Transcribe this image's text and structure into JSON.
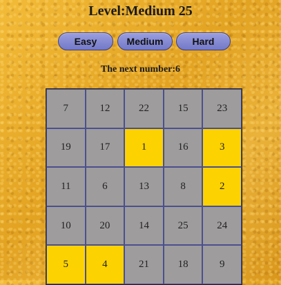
{
  "title": "Level:Medium 25",
  "levels": {
    "easy": "Easy",
    "medium": "Medium",
    "hard": "Hard"
  },
  "next_number_text": "The next number:6",
  "colors": {
    "cell": "#9e9c9c",
    "found_cell": "#fcd200",
    "button": "#7c82cc"
  },
  "grid": [
    [
      {
        "n": "7",
        "found": false
      },
      {
        "n": "12",
        "found": false
      },
      {
        "n": "22",
        "found": false
      },
      {
        "n": "15",
        "found": false
      },
      {
        "n": "23",
        "found": false
      }
    ],
    [
      {
        "n": "19",
        "found": false
      },
      {
        "n": "17",
        "found": false
      },
      {
        "n": "1",
        "found": true
      },
      {
        "n": "16",
        "found": false
      },
      {
        "n": "3",
        "found": true
      }
    ],
    [
      {
        "n": "11",
        "found": false
      },
      {
        "n": "6",
        "found": false
      },
      {
        "n": "13",
        "found": false
      },
      {
        "n": "8",
        "found": false
      },
      {
        "n": "2",
        "found": true
      }
    ],
    [
      {
        "n": "10",
        "found": false
      },
      {
        "n": "20",
        "found": false
      },
      {
        "n": "14",
        "found": false
      },
      {
        "n": "25",
        "found": false
      },
      {
        "n": "24",
        "found": false
      }
    ],
    [
      {
        "n": "5",
        "found": true
      },
      {
        "n": "4",
        "found": true
      },
      {
        "n": "21",
        "found": false
      },
      {
        "n": "18",
        "found": false
      },
      {
        "n": "9",
        "found": false
      }
    ]
  ]
}
